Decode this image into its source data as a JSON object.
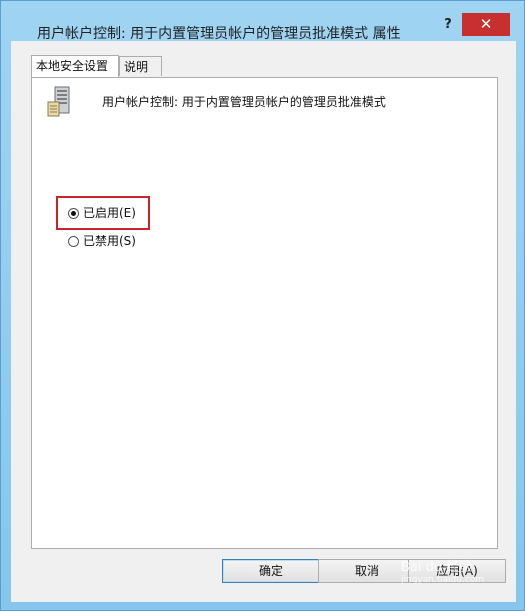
{
  "window": {
    "title": "用户帐户控制: 用于内置管理员帐户的管理员批准模式 属性",
    "help": "?",
    "close": "✕"
  },
  "tabs": [
    {
      "label": "本地安全设置",
      "active": true
    },
    {
      "label": "说明",
      "active": false
    }
  ],
  "policy": {
    "icon": "server-icon",
    "name": "用户帐户控制: 用于内置管理员帐户的管理员批准模式"
  },
  "options": [
    {
      "label": "已启用(E)",
      "selected": true
    },
    {
      "label": "已禁用(S)",
      "selected": false
    }
  ],
  "buttons": {
    "ok": "确定",
    "cancel": "取消",
    "apply": "应用(A)"
  },
  "watermark": {
    "text": "Bai du 经验",
    "url": "jingyan.baidu.com"
  },
  "colors": {
    "close": "#c7302f",
    "highlight": "#c8252c",
    "accent": "#5aaee0"
  }
}
